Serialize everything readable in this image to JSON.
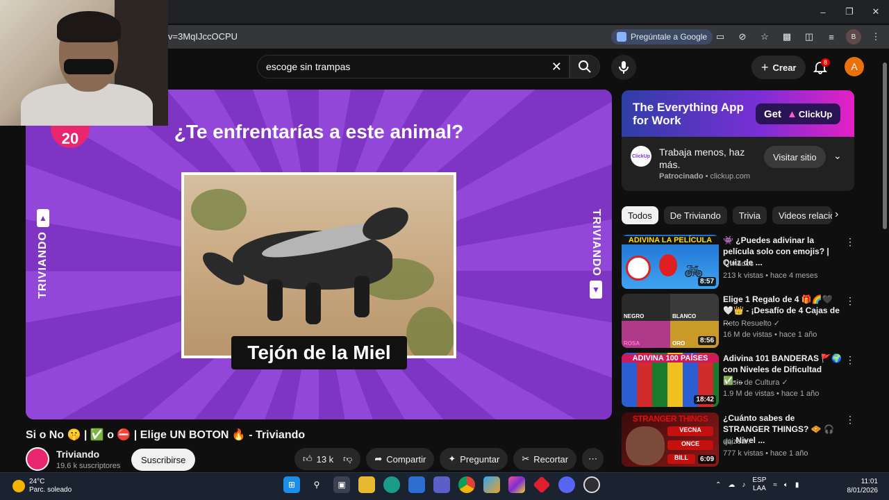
{
  "browser": {
    "url": "v=3MqIJccOCPU",
    "ask_google": "Pregúntale a Google",
    "profile_initial": "B",
    "window_controls": [
      "minimize-icon",
      "restore-icon",
      "close-icon"
    ]
  },
  "header": {
    "search_value": "escoge sin trampas",
    "create_label": "Crear",
    "notification_count": "8",
    "avatar_initial": "A"
  },
  "player": {
    "question": "¿Te enfrentarías a este animal?",
    "number": "20",
    "side_text": "TRIVIANDO",
    "caption": "Tejón de la Miel"
  },
  "video": {
    "title": "Si o No 🤫 | ✅ o ⛔ | Elige UN BOTON 🔥 - Triviando",
    "channel": "Triviando",
    "subscribers": "19.6 k suscriptores",
    "subscribe_label": "Suscribirse",
    "likes": "13 k",
    "share_label": "Compartir",
    "ask_label": "Preguntar",
    "clip_label": "Recortar"
  },
  "ad": {
    "headline": "The Everything App for Work",
    "cta_banner": "Get",
    "brand": "ClickUp",
    "logo_text": "ClickUp",
    "body": "Trabaja menos, haz más.",
    "sponsored": "Patrocinado",
    "domain": "clickup.com",
    "visit_label": "Visitar sitio"
  },
  "chips": [
    "Todos",
    "De Triviando",
    "Trivia",
    "Videos relacio"
  ],
  "recommendations": [
    {
      "title": "👾 ¿Puedes adivinar la película solo con emojis? | Quiz de ...",
      "channel": "Triviados",
      "meta": "213 k vistas • hace 4 meses",
      "duration": "8:57",
      "thumb_text": "ADIVINA LA PELÍCULA",
      "colors": [
        "#1d6fd1",
        "#3fa3f0"
      ]
    },
    {
      "title": "Elige 1 Regalo de 4 🎁🌈🖤🤍👑 - ¡Desafío de 4 Cajas de ...",
      "channel": "Reto Resuelto ✓",
      "meta": "16 M de vistas • hace 1 año",
      "duration": "8:56",
      "thumb_labels": [
        "NEGRO",
        "BLANCO",
        "ROSA",
        "ORO"
      ],
      "colors": [
        "#222222",
        "#5a2a7a"
      ]
    },
    {
      "title": "Adivina 101 BANDERAS 🚩🌍 con Niveles de Dificultad ✅-...",
      "channel": "Dosis de Cultura ✓",
      "meta": "1.9 M de vistas • hace 1 año",
      "duration": "18:42",
      "thumb_text": "ADIVINA 100 PAÍSES",
      "colors": [
        "#1a7a2e",
        "#2b5fd1"
      ]
    },
    {
      "title": "¿Cuánto sabes de STRANGER THINGS? 🧇 🎧 🚲 Nivel ...",
      "channel": "quizear.",
      "meta": "777 k vistas • hace 1 año",
      "duration": "6:09",
      "thumb_text": "STRANGER THINGS",
      "thumb_options": [
        "VECNA",
        "ONCE",
        "BILL"
      ],
      "colors": [
        "#3b0a0a",
        "#8a1a1a"
      ]
    }
  ],
  "taskbar": {
    "temp": "24°C",
    "weather": "Parc. soleado",
    "lang1": "ESP",
    "lang2": "LAA",
    "time": "11:01",
    "date": "8/01/2026"
  }
}
